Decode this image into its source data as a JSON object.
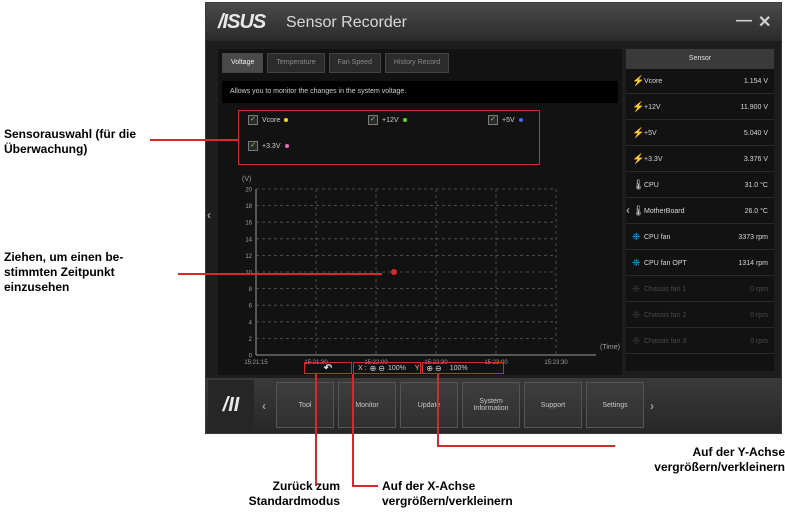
{
  "window": {
    "logo": "/ISUS",
    "title": "Sensor Recorder",
    "minimize": "—",
    "close": "✕"
  },
  "tabs": [
    {
      "label": "Voltage",
      "active": true
    },
    {
      "label": "Temperature",
      "active": false
    },
    {
      "label": "Fan Speed",
      "active": false
    },
    {
      "label": "History Record",
      "active": false
    }
  ],
  "description": "Allows you to monitor the changes in the system voltage.",
  "sensor_checkboxes": [
    {
      "label": "Vcore",
      "color": "#f2d820",
      "checked": true
    },
    {
      "label": "+12V",
      "color": "#5ad23a",
      "checked": true
    },
    {
      "label": "+5V",
      "color": "#3a6cf0",
      "checked": true
    },
    {
      "label": "+3.3V",
      "color": "#e86ab8",
      "checked": true
    }
  ],
  "chart_data": {
    "type": "line",
    "ylabel": "(V)",
    "xlabel": "(Time)",
    "yticks": [
      0,
      2,
      4,
      6,
      8,
      10,
      12,
      14,
      16,
      18,
      20
    ],
    "ylim": [
      0,
      20
    ],
    "xticks": [
      "15:21:15",
      "15:21:30",
      "15:22:00",
      "15:22:30",
      "15:23:00",
      "15:23:30"
    ],
    "grid": true,
    "cursor": {
      "x": "15:22:00",
      "y": 10
    }
  },
  "zoom": {
    "x_label": "X :",
    "x_value": "100%",
    "y_label": "Y :",
    "y_value": "100%"
  },
  "side_panel": {
    "header": "Sensor",
    "rows": [
      {
        "icon": "⚡",
        "name": "Vcore",
        "value": "1.154 V",
        "disabled": false
      },
      {
        "icon": "⚡",
        "name": "+12V",
        "value": "11.900 V",
        "disabled": false
      },
      {
        "icon": "⚡",
        "name": "+5V",
        "value": "5.040 V",
        "disabled": false
      },
      {
        "icon": "⚡",
        "name": "+3.3V",
        "value": "3.376 V",
        "disabled": false
      },
      {
        "icon": "🌡",
        "name": "CPU",
        "value": "31.0 °C",
        "disabled": false
      },
      {
        "icon": "🌡",
        "name": "MotherBoard",
        "value": "26.0 °C",
        "disabled": false
      },
      {
        "icon": "❈",
        "name": "CPU fan",
        "value": "3373 rpm",
        "disabled": false
      },
      {
        "icon": "❈",
        "name": "CPU fan OPT",
        "value": "1314 rpm",
        "disabled": false
      },
      {
        "icon": "❈",
        "name": "Chassis fan 1",
        "value": "0 rpm",
        "disabled": true
      },
      {
        "icon": "❈",
        "name": "Chassis fan 2",
        "value": "0 rpm",
        "disabled": true
      },
      {
        "icon": "❈",
        "name": "Chassis fan 3",
        "value": "0 rpm",
        "disabled": true
      }
    ]
  },
  "bottom_bar": {
    "logo": "/II",
    "buttons": [
      "Tool",
      "Monitor",
      "Update",
      "System Information",
      "Support",
      "Settings"
    ]
  },
  "callouts": {
    "sensor_select": "Sensorauswahl (für die Überwachung)",
    "drag": "Ziehen, um einen be-stimmten Zeitpunkt einzusehen",
    "reset": "Zurück zum Standardmodus",
    "x_zoom": "Auf der X-Achse vergrößern/verkleinern",
    "y_zoom": "Auf der Y-Achse vergrößern/verkleinern"
  }
}
